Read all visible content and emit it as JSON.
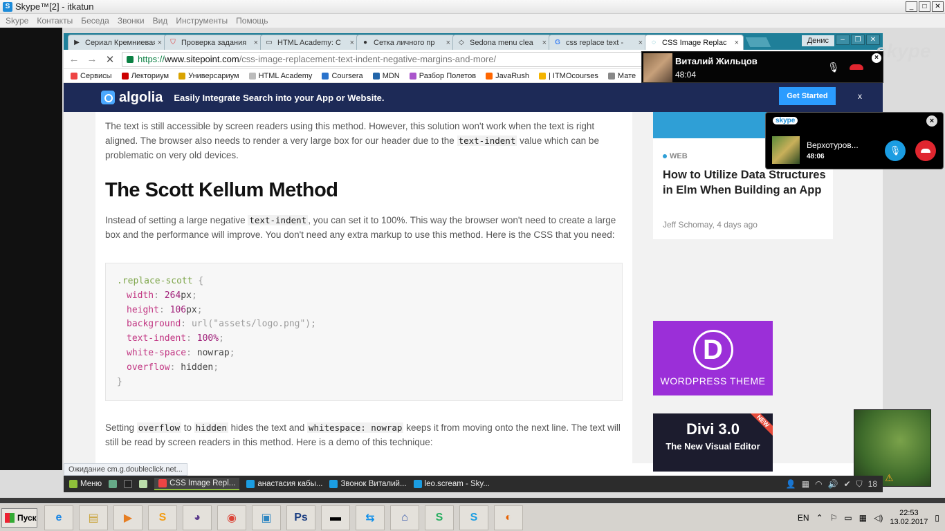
{
  "skype": {
    "title": "Skype™[2] - itkatun",
    "menu": [
      "Skype",
      "Контакты",
      "Беседа",
      "Звонки",
      "Вид",
      "Инструменты",
      "Помощь"
    ],
    "watermark": "skype"
  },
  "chrome": {
    "tabs": [
      {
        "label": "Сериал Кремниевая",
        "icon": "play-icon"
      },
      {
        "label": "Проверка задания",
        "icon": "shield-icon"
      },
      {
        "label": "HTML Academy: C",
        "icon": "page-icon"
      },
      {
        "label": "Сетка личного пр",
        "icon": "github-icon"
      },
      {
        "label": "Sedona menu clea",
        "icon": "codepen-icon"
      },
      {
        "label": "css replace text - ",
        "icon": "google-icon"
      },
      {
        "label": "CSS Image Replac",
        "icon": "loading-icon",
        "active": true
      }
    ],
    "user": "Денис",
    "url": {
      "https": "https://",
      "domain": "www.sitepoint.com",
      "path": "/css-image-replacement-text-indent-negative-margins-and-more/"
    },
    "bookmarks": [
      "Сервисы",
      "Лекториум",
      "Универсариум",
      "HTML Academy",
      "Coursera",
      "MDN",
      "Разбор Полетов",
      "JavaRush",
      "| ITMOcourses",
      "Мате"
    ],
    "status": "Ожидание cm.g.doubleclick.net..."
  },
  "algolia": {
    "logo": "algolia",
    "message": "Easily Integrate Search into your App or Website.",
    "cta": "Get Started",
    "close": "x"
  },
  "article": {
    "p1_a": "The text is still accessible by screen readers using this method. However, this solution won't work when the text is right aligned. The browser also needs to render a very large box for our header due to the ",
    "p1_code": "text-indent",
    "p1_b": " value which can be problematic on very old devices.",
    "heading": "The Scott Kellum Method",
    "p2_a": "Instead of setting a large negative ",
    "p2_code": "text-indent",
    "p2_b": ", you can set it to 100%. This way the browser won't need to create a large box and the performance will improve. You don't need any extra markup to use this method. Here is the CSS that you need:",
    "code": {
      "selector": ".replace-scott",
      "open": " {",
      "close": "}",
      "lines": [
        {
          "prop": "width",
          "value": "264",
          "unit": "px"
        },
        {
          "prop": "height",
          "value": "106",
          "unit": "px"
        },
        {
          "prop": "background",
          "value": "url(\"assets/logo.png\")",
          "unit": ""
        },
        {
          "prop": "text-indent",
          "value": "100%",
          "unit": ""
        },
        {
          "prop": "white-space",
          "value": "nowrap",
          "unit": ""
        },
        {
          "prop": "overflow",
          "value": "hidden",
          "unit": ""
        }
      ]
    },
    "p3_a": "Setting ",
    "p3_code1": "overflow",
    "p3_b": " to ",
    "p3_code2": "hidden",
    "p3_c": " hides the text and ",
    "p3_code3": "whitespace: nowrap",
    "p3_d": " keeps it from moving onto the next line. The text will still be read by screen readers in this method. Here is a demo of this technique:"
  },
  "sidebar": {
    "tag": "WEB",
    "title": "How to Utilize Data Structures in Elm When Building an App",
    "meta": "Jeff Schomay, 4 days ago",
    "ad1_text": "WORDPRESS THEME",
    "ad1_letter": "D",
    "ad2_title": "Divi 3.0",
    "ad2_sub": "The New Visual Editor",
    "ad2_badge": "NEW"
  },
  "calls": {
    "call1": {
      "name": "Виталий Жильцов",
      "time": "48:04"
    },
    "call2": {
      "name": "Верхотуров...",
      "time": "48:06",
      "brand": "skype"
    }
  },
  "mint_panel": {
    "menu": "Меню",
    "items": [
      {
        "label": "CSS Image Repl...",
        "active": true
      },
      {
        "label": "анастасия кабы..."
      },
      {
        "label": "Звонок Виталий..."
      },
      {
        "label": "leo.scream - Sky..."
      }
    ],
    "tray_num": "18"
  },
  "taskbar": {
    "start": "Пуск",
    "icons": [
      "ie-icon",
      "folder-icon",
      "media-icon",
      "sublime-icon",
      "cat-icon",
      "chrome-icon",
      "image-icon",
      "photoshop-icon",
      "terminal-icon",
      "teamviewer-icon",
      "remote-icon",
      "s-app-icon",
      "skype-icon",
      "firefox-icon"
    ],
    "lang": "EN",
    "time": "22:53",
    "date": "13.02.2017"
  },
  "colors": {
    "tabstrip": "#1f7f99",
    "algolia_bg": "#1d2a57",
    "cta": "#2b9cff",
    "hangup": "#e0262f"
  }
}
